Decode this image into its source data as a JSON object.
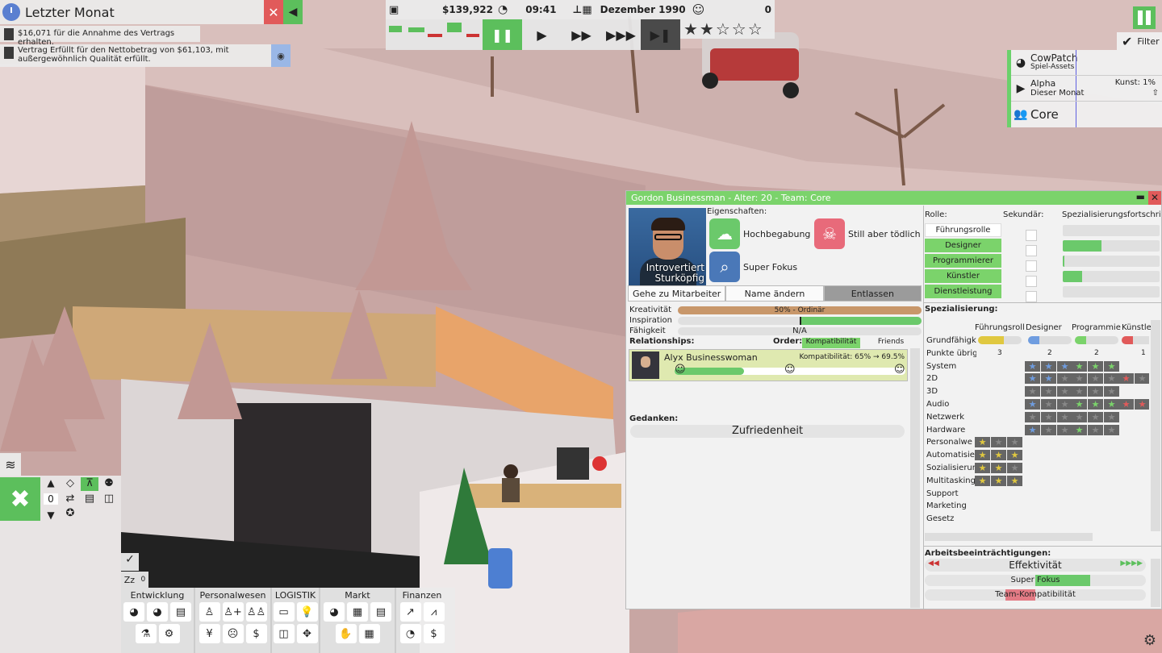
{
  "notifications": {
    "title": "Letzter Monat",
    "messages": [
      "$16,071 für die Annahme des Vertrags erhalten.",
      "Vertrag Erfüllt für den Nettobetrag von $61,103, mit außergewöhnlich Qualität erfüllt."
    ]
  },
  "topbar": {
    "money": "$139,922",
    "time": "09:41",
    "date": "Dezember 1990",
    "reputation": "0",
    "rating_stars": 2,
    "rating_max": 5
  },
  "speed_controls": [
    "pause",
    "play",
    "fast",
    "faster",
    "skip"
  ],
  "filter_label": "Filter",
  "projects": [
    {
      "title": "CowPatch",
      "subtitle": "Spiel-Assets",
      "icon": "gamepad-icon"
    },
    {
      "title": "Alpha",
      "subtitle": "Dieser Monat",
      "extra": "Kunst: 1%",
      "icon": "play-icon"
    }
  ],
  "team_label": "Core",
  "employee": {
    "title": "Gordon Businessman - Alter: 20 - Team: Core",
    "portrait_text": [
      "Introvertiert",
      "Sturköpfig"
    ],
    "traits_label": "Eigenschaften:",
    "traits": [
      {
        "name": "Hochbegabung",
        "color": "#6bc96b",
        "icon": "brain-icon"
      },
      {
        "name": "Still aber tödlich",
        "color": "#e86a7a",
        "icon": "skull-icon"
      },
      {
        "name": "Super Fokus",
        "color": "#4a78b8",
        "icon": "magnifier-icon"
      }
    ],
    "buttons": [
      "Gehe zu Mitarbeiter",
      "Name ändern",
      "Entlassen"
    ],
    "stats": [
      {
        "label": "Kreativität",
        "text": "50% - Ordinär",
        "fill": 1.0,
        "color": "#c8976a"
      },
      {
        "label": "Inspiration",
        "text": "",
        "fill": 0.5,
        "color": "#6bc96b"
      },
      {
        "label": "Fähigkeit",
        "text": "N/A",
        "fill": 0,
        "color": "#ccc"
      }
    ],
    "relationships_label": "Relationships:",
    "order_label": "Order:",
    "order_options": [
      "Kompatibilität",
      "Friends"
    ],
    "relation": {
      "name": "Alyx Businesswoman",
      "compat": "Kompatibilität: 65% → 69.5%",
      "fill": 0.5
    },
    "thoughts_label": "Gedanken:",
    "thought": "Zufriedenheit",
    "roles_header": {
      "role": "Rolle:",
      "secondary": "Sekundär:",
      "progress": "Spezialisierungsfortschri"
    },
    "roles": [
      {
        "name": "Führungsrolle",
        "active": false,
        "progress": 0
      },
      {
        "name": "Designer",
        "active": true,
        "progress": 0.4
      },
      {
        "name": "Programmierer",
        "active": true,
        "progress": 0.02
      },
      {
        "name": "Künstler",
        "active": true,
        "progress": 0.2
      },
      {
        "name": "Dienstleistung",
        "active": true,
        "progress": 0
      }
    ],
    "spec_label": "Spezialisierung:",
    "spec_columns": [
      "Führungsroll",
      "Designer",
      "Programmie",
      "Künstle"
    ],
    "spec_rows": [
      "Grundfähigk",
      "Punkte übrig",
      "System",
      "2D",
      "3D",
      "Audio",
      "Netzwerk",
      "Hardware",
      "Personalwe",
      "Automatisie",
      "Sozialisierun",
      "Multitasking",
      "Support",
      "Marketing",
      "Gesetz"
    ],
    "points_left": [
      "3",
      "2",
      "2",
      "1"
    ],
    "impair_label": "Arbeitsbeeinträchtigungen:",
    "impairments": [
      {
        "label": "Effektivität"
      },
      {
        "label": "Super Fokus"
      },
      {
        "label": "Team-Kompatibilität"
      }
    ]
  },
  "left_tools": {
    "counter": "0",
    "badge_count": "0"
  },
  "menu_groups": [
    "Entwicklung",
    "Personalwesen",
    "LOGISTIK",
    "Markt",
    "Finanzen"
  ],
  "colors": {
    "accent_green": "#5cbf5c",
    "close_red": "#e15a5a",
    "star_blue": "#6f9de0",
    "star_gold": "#e0c840"
  }
}
